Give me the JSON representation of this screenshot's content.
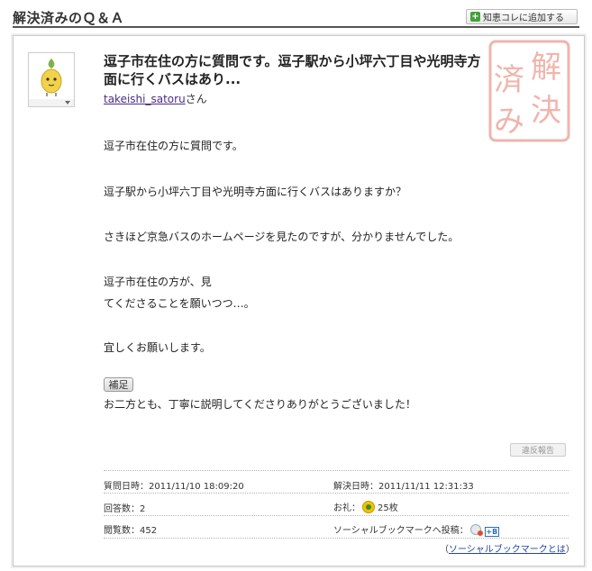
{
  "header": {
    "title": "解決済みのＱ＆Ａ",
    "add_button": {
      "icon": "plus-icon",
      "label": "知恵コレに追加する"
    }
  },
  "stamp": {
    "chars": [
      "解",
      "決",
      "済",
      "み"
    ]
  },
  "question": {
    "title": "逗子市在住の方に質問です。逗子駅から小坪六丁目や光明寺方面に行くバスはあり...",
    "user_name": "takeishi_satoru",
    "user_suffix": "さん",
    "body": {
      "p1": "逗子市在住の方に質問です。",
      "p2": "逗子駅から小坪六丁目や光明寺方面に行くバスはありますか？",
      "p3": "さきほど京急バスのホームページを見たのですが、分かりませんでした。",
      "p4a": "逗子市在住の方が、見",
      "p4b": "てくださることを願いつつ…。",
      "p5": "宜しくお願いします。"
    },
    "supplement_label": "補足",
    "supplement_text": "お二方とも、丁寧に説明してくださりありがとうございました！",
    "report_label": "違反報告"
  },
  "meta": {
    "asked_label": "質問日時：",
    "asked_value": "2011/11/10 18:09:20",
    "resolved_label": "解決日時：",
    "resolved_value": "2011/11/11 12:31:33",
    "answers_label": "回答数：",
    "answers_value": "2",
    "reward_label": "お礼：",
    "reward_value": "25枚",
    "views_label": "閲覧数：",
    "views_value": "452",
    "bookmark_label": "ソーシャルブックマークへ投稿：",
    "bookmark_about_open": "（",
    "bookmark_about_link": "ソーシャルブックマークとは",
    "bookmark_about_close": "）"
  },
  "colors": {
    "link": "#4b2c8c",
    "stamp": "#e27a6a",
    "add_icon": "#46a13a",
    "coin": "#f2c200"
  }
}
